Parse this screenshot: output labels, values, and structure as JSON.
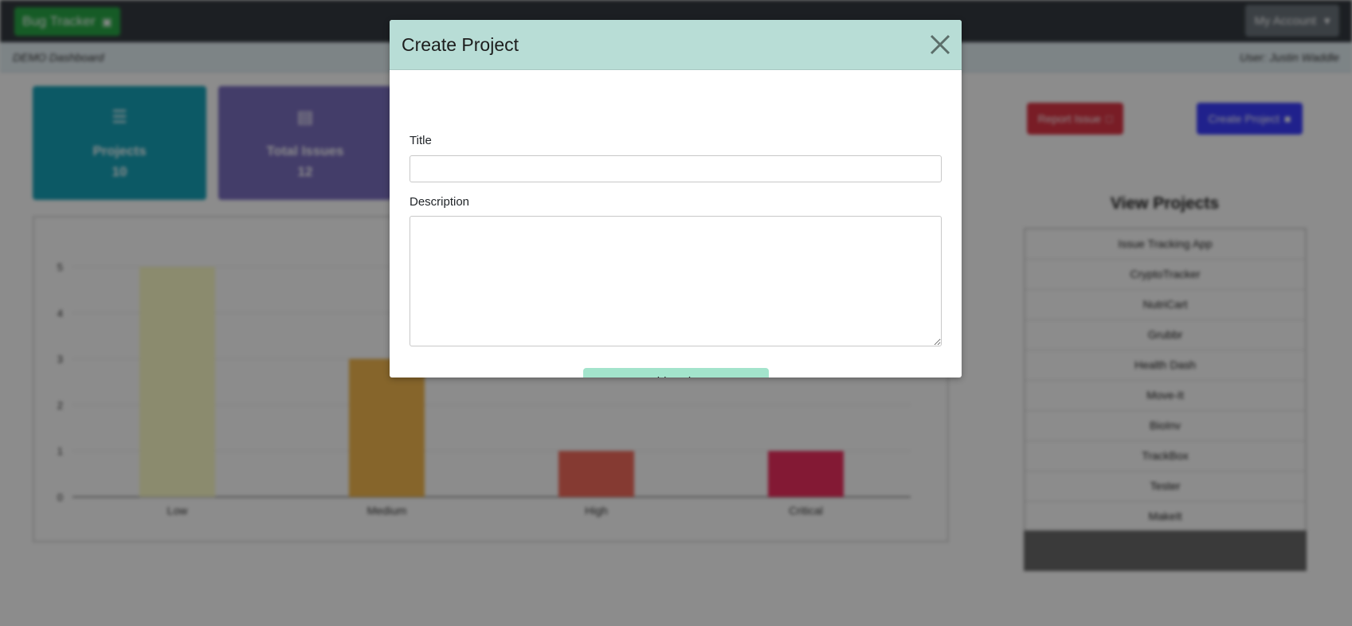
{
  "navbar": {
    "brand_label": "Bug Tracker",
    "account_label": "My Account"
  },
  "subheader": {
    "dashboard_label": "DEMO Dashboard",
    "user_label": "User: Justin Waddle"
  },
  "cards": [
    {
      "title": "Projects",
      "value": "10",
      "color": "#17a2b8",
      "icon": "layers-icon"
    },
    {
      "title": "Total Issues",
      "value": "12",
      "color": "#7b6fc0",
      "icon": "document-chart-icon"
    }
  ],
  "actions": {
    "report_label": "Report Issue",
    "create_label": "Create Project",
    "report_color": "#dc3545",
    "create_color": "#3b3dff"
  },
  "view_projects": {
    "title": "View Projects",
    "items": [
      "Issue Tracking App",
      "CryptoTracker",
      "NutriCart",
      "Grubbr",
      "Health Dash",
      "Move-It",
      "BioInv",
      "TrackBox",
      "Tester",
      "MakeIt"
    ]
  },
  "chart_data": {
    "type": "bar",
    "categories": [
      "Low",
      "Medium",
      "High",
      "Critical"
    ],
    "values": [
      5,
      3,
      1,
      1
    ],
    "colors": [
      "#fdfdc8",
      "#f4b94f",
      "#f36b5c",
      "#ee2f5f"
    ],
    "ylim": [
      0,
      5
    ],
    "yticks": [
      0,
      1,
      2,
      3,
      4,
      5
    ],
    "grid": true
  },
  "modal": {
    "title": "Create Project",
    "title_label": "Title",
    "title_value": "",
    "description_label": "Description",
    "description_value": "",
    "submit_label": "Add Project"
  }
}
